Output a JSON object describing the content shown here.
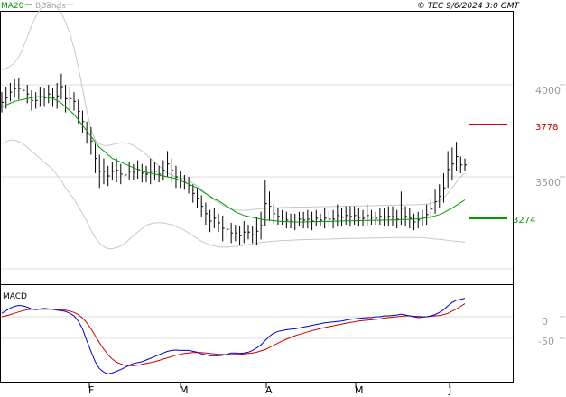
{
  "header": {
    "legend_ma": "MA20",
    "legend_bb": "BBands",
    "copyright": "© TEC 9/6/2024 3:0 GMT"
  },
  "colors": {
    "price": "#000000",
    "ma20": "#009900",
    "bbands": "#c8c8c8",
    "resistance": "#cc0000",
    "support": "#009900",
    "macd": "#0000cc",
    "signal": "#cc0000",
    "grid": "#dddddd"
  },
  "chart_data": [
    {
      "type": "bar",
      "title": "",
      "y_ticks": [
        "4000",
        "3500"
      ],
      "ylim": [
        3000,
        4500
      ],
      "x_ticks": [
        "F",
        "M",
        "A",
        "M",
        "J"
      ],
      "levels": [
        {
          "label": "3778",
          "value": 3778,
          "color": "#cc0000"
        },
        {
          "label": "3274",
          "value": 3274,
          "color": "#009900"
        }
      ],
      "ohlc_high": [
        3960,
        3990,
        4010,
        4030,
        4040,
        4020,
        4000,
        3970,
        3960,
        3990,
        3980,
        4000,
        3980,
        4010,
        4060,
        4000,
        3990,
        3960,
        3920,
        3860,
        3800,
        3770,
        3680,
        3620,
        3600,
        3560,
        3580,
        3600,
        3570,
        3560,
        3580,
        3570,
        3590,
        3570,
        3560,
        3600,
        3580,
        3560,
        3590,
        3640,
        3600,
        3560,
        3530,
        3510,
        3500,
        3460,
        3440,
        3400,
        3360,
        3320,
        3330,
        3300,
        3290,
        3260,
        3250,
        3240,
        3230,
        3260,
        3240,
        3230,
        3280,
        3310,
        3480,
        3420,
        3350,
        3330,
        3320,
        3310,
        3300,
        3300,
        3310,
        3310,
        3320,
        3310,
        3320,
        3300,
        3330,
        3310,
        3320,
        3350,
        3330,
        3340,
        3340,
        3340,
        3330,
        3320,
        3350,
        3320,
        3310,
        3330,
        3330,
        3340,
        3340,
        3320,
        3420,
        3340,
        3330,
        3300,
        3310,
        3320,
        3350,
        3380,
        3430,
        3460,
        3520,
        3640,
        3660,
        3690,
        3610,
        3600
      ],
      "ohlc_low": [
        3850,
        3870,
        3910,
        3930,
        3920,
        3920,
        3900,
        3860,
        3870,
        3880,
        3880,
        3900,
        3880,
        3870,
        3920,
        3850,
        3860,
        3860,
        3790,
        3740,
        3680,
        3620,
        3520,
        3440,
        3460,
        3450,
        3480,
        3470,
        3460,
        3460,
        3480,
        3480,
        3490,
        3470,
        3470,
        3460,
        3480,
        3470,
        3480,
        3500,
        3470,
        3440,
        3440,
        3430,
        3410,
        3360,
        3330,
        3280,
        3240,
        3200,
        3220,
        3200,
        3150,
        3170,
        3140,
        3150,
        3130,
        3140,
        3160,
        3140,
        3130,
        3160,
        3230,
        3260,
        3250,
        3240,
        3240,
        3220,
        3220,
        3210,
        3230,
        3220,
        3220,
        3210,
        3230,
        3230,
        3220,
        3230,
        3220,
        3230,
        3230,
        3240,
        3230,
        3240,
        3230,
        3230,
        3230,
        3240,
        3240,
        3240,
        3230,
        3230,
        3230,
        3220,
        3240,
        3230,
        3220,
        3210,
        3220,
        3230,
        3240,
        3270,
        3300,
        3330,
        3360,
        3440,
        3480,
        3530,
        3520,
        3530
      ],
      "ma20": [
        3880,
        3890,
        3900,
        3910,
        3915,
        3920,
        3925,
        3930,
        3935,
        3935,
        3935,
        3930,
        3925,
        3915,
        3900,
        3880,
        3860,
        3840,
        3810,
        3780,
        3750,
        3720,
        3690,
        3660,
        3640,
        3620,
        3600,
        3590,
        3580,
        3570,
        3560,
        3550,
        3540,
        3530,
        3525,
        3520,
        3515,
        3510,
        3505,
        3500,
        3495,
        3490,
        3480,
        3470,
        3460,
        3450,
        3440,
        3425,
        3410,
        3395,
        3380,
        3370,
        3355,
        3340,
        3325,
        3310,
        3300,
        3290,
        3285,
        3280,
        3275,
        3270,
        3265,
        3265,
        3262,
        3260,
        3258,
        3257,
        3256,
        3255,
        3255,
        3255,
        3256,
        3256,
        3257,
        3258,
        3258,
        3258,
        3259,
        3260,
        3260,
        3261,
        3261,
        3262,
        3262,
        3263,
        3263,
        3264,
        3264,
        3264,
        3265,
        3265,
        3266,
        3266,
        3268,
        3268,
        3269,
        3270,
        3272,
        3274,
        3278,
        3282,
        3288,
        3295,
        3305,
        3318,
        3330,
        3345,
        3360,
        3375
      ],
      "bb_upper": [
        4080,
        4090,
        4100,
        4120,
        4150,
        4200,
        4260,
        4320,
        4370,
        4410,
        4440,
        4450,
        4440,
        4420,
        4390,
        4340,
        4280,
        4200,
        4100,
        3980,
        3860,
        3760,
        3700,
        3680,
        3670,
        3670,
        3675,
        3680,
        3685,
        3685,
        3680,
        3670,
        3655,
        3640,
        3620,
        3600,
        3580,
        3560,
        3540,
        3520,
        3510,
        3500,
        3495,
        3490,
        3480,
        3465,
        3450,
        3430,
        3410,
        3390,
        3375,
        3360,
        3345,
        3335,
        3325,
        3320,
        3318,
        3318,
        3320,
        3322,
        3325,
        3327,
        3329,
        3330,
        3332,
        3333,
        3334,
        3335,
        3335,
        3336,
        3336,
        3336,
        3336,
        3337,
        3337,
        3338,
        3338,
        3338,
        3339,
        3339,
        3340,
        3340,
        3341,
        3341,
        3342,
        3342,
        3343,
        3343,
        3344,
        3344,
        3345,
        3345,
        3346,
        3346,
        3347,
        3347,
        3348,
        3348,
        3349,
        3350,
        3352,
        3356,
        3362,
        3370,
        3385,
        3410,
        3440,
        3470,
        3500,
        3520
      ],
      "bb_lower": [
        3680,
        3690,
        3700,
        3700,
        3690,
        3680,
        3660,
        3640,
        3620,
        3600,
        3580,
        3560,
        3540,
        3510,
        3480,
        3440,
        3410,
        3380,
        3340,
        3300,
        3260,
        3210,
        3170,
        3140,
        3120,
        3110,
        3110,
        3115,
        3125,
        3140,
        3160,
        3180,
        3200,
        3220,
        3235,
        3245,
        3250,
        3252,
        3250,
        3245,
        3240,
        3230,
        3220,
        3210,
        3195,
        3180,
        3165,
        3150,
        3140,
        3130,
        3125,
        3120,
        3118,
        3118,
        3120,
        3122,
        3125,
        3128,
        3132,
        3136,
        3140,
        3143,
        3146,
        3148,
        3150,
        3152,
        3154,
        3155,
        3156,
        3157,
        3158,
        3159,
        3160,
        3160,
        3161,
        3161,
        3162,
        3162,
        3163,
        3163,
        3164,
        3164,
        3165,
        3165,
        3166,
        3166,
        3167,
        3167,
        3168,
        3168,
        3169,
        3169,
        3170,
        3170,
        3170,
        3170,
        3170,
        3170,
        3170,
        3170,
        3168,
        3165,
        3162,
        3160,
        3158,
        3155,
        3152,
        3150,
        3148,
        3145
      ]
    },
    {
      "type": "line",
      "title": "MACD",
      "y_ticks": [
        "0",
        "-50"
      ],
      "ylim": [
        -160,
        60
      ],
      "series": [
        {
          "name": "",
          "color": "#0000cc",
          "values": [
            8,
            14,
            20,
            24,
            26,
            25,
            22,
            18,
            16,
            18,
            19,
            18,
            17,
            15,
            14,
            12,
            8,
            2,
            -10,
            -28,
            -55,
            -80,
            -104,
            -120,
            -128,
            -132,
            -130,
            -126,
            -122,
            -117,
            -112,
            -108,
            -106,
            -104,
            -100,
            -96,
            -92,
            -88,
            -84,
            -80,
            -78,
            -77,
            -78,
            -78,
            -78,
            -80,
            -82,
            -86,
            -88,
            -90,
            -90,
            -90,
            -89,
            -87,
            -84,
            -84,
            -85,
            -84,
            -82,
            -78,
            -72,
            -65,
            -55,
            -45,
            -38,
            -34,
            -32,
            -30,
            -29,
            -28,
            -26,
            -24,
            -22,
            -20,
            -18,
            -16,
            -14,
            -13,
            -12,
            -11,
            -10,
            -8,
            -6,
            -5,
            -4,
            -3,
            -2,
            -2,
            0,
            0,
            2,
            2,
            3,
            4,
            6,
            4,
            2,
            0,
            -2,
            -1,
            0,
            2,
            5,
            10,
            16,
            25,
            33,
            38,
            40,
            42
          ]
        },
        {
          "name": "",
          "color": "#cc0000",
          "values": [
            0,
            2,
            5,
            8,
            11,
            14,
            16,
            17,
            17,
            17,
            17,
            17,
            17,
            17,
            16,
            15,
            13,
            10,
            5,
            -3,
            -14,
            -28,
            -44,
            -60,
            -75,
            -88,
            -98,
            -105,
            -109,
            -112,
            -113,
            -113,
            -112,
            -110,
            -108,
            -106,
            -104,
            -101,
            -98,
            -95,
            -92,
            -89,
            -87,
            -85,
            -84,
            -83,
            -83,
            -83,
            -84,
            -85,
            -86,
            -87,
            -87,
            -88,
            -87,
            -87,
            -87,
            -86,
            -85,
            -84,
            -82,
            -79,
            -76,
            -71,
            -66,
            -61,
            -56,
            -52,
            -48,
            -44,
            -41,
            -38,
            -35,
            -32,
            -30,
            -27,
            -25,
            -23,
            -21,
            -19,
            -17,
            -15,
            -13,
            -12,
            -10,
            -9,
            -8,
            -7,
            -6,
            -5,
            -3,
            -2,
            -1,
            0,
            1,
            2,
            2,
            1,
            1,
            0,
            0,
            1,
            2,
            3,
            5,
            8,
            13,
            18,
            24,
            30
          ]
        }
      ]
    }
  ]
}
